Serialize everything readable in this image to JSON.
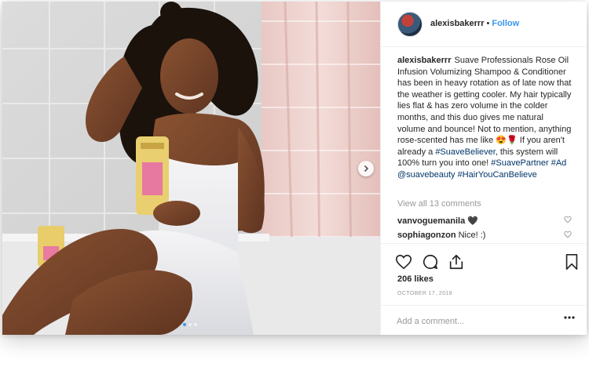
{
  "post": {
    "username": "alexisbakerrr",
    "follow_label": "Follow",
    "separator": "•",
    "caption_parts": [
      {
        "text": "Suave Professionals Rose Oil Infusion Volumizing Shampoo & Conditioner has been in heavy rotation as of late now that the weather is getting cooler. My hair typically lies flat & has zero volume in the colder months, and this duo gives me natural volume and bounce! Not to mention, anything rose-scented has me like 😍🌹 If you aren't already a ",
        "tag": false
      },
      {
        "text": "#SuaveBeliever",
        "tag": true
      },
      {
        "text": ", this system will 100% turn you into one! ",
        "tag": false
      },
      {
        "text": "#SuavePartner",
        "tag": true
      },
      {
        "text": " ",
        "tag": false
      },
      {
        "text": "#Ad",
        "tag": true
      },
      {
        "text": " ",
        "tag": false
      },
      {
        "text": "@suavebeauty",
        "tag": true
      },
      {
        "text": " ",
        "tag": false
      },
      {
        "text": "#HairYouCanBelieve",
        "tag": true
      }
    ],
    "view_all_comments": "View all 13 comments",
    "comments": [
      {
        "user": "vanvoguemanila",
        "text": "🖤"
      },
      {
        "user": "sophiagonzon",
        "text": "Nice! :)"
      }
    ],
    "likes": "206 likes",
    "date": "OCTOBER 17, 2018",
    "add_comment_placeholder": "Add a comment..."
  },
  "carousel": {
    "count": 3,
    "active": 0
  },
  "colors": {
    "accent": "#3897f0",
    "tag": "#003569",
    "muted": "#999999"
  },
  "icons": [
    "heart-icon",
    "comment-icon",
    "share-icon",
    "bookmark-icon",
    "more-options-icon",
    "chevron-right-icon"
  ]
}
